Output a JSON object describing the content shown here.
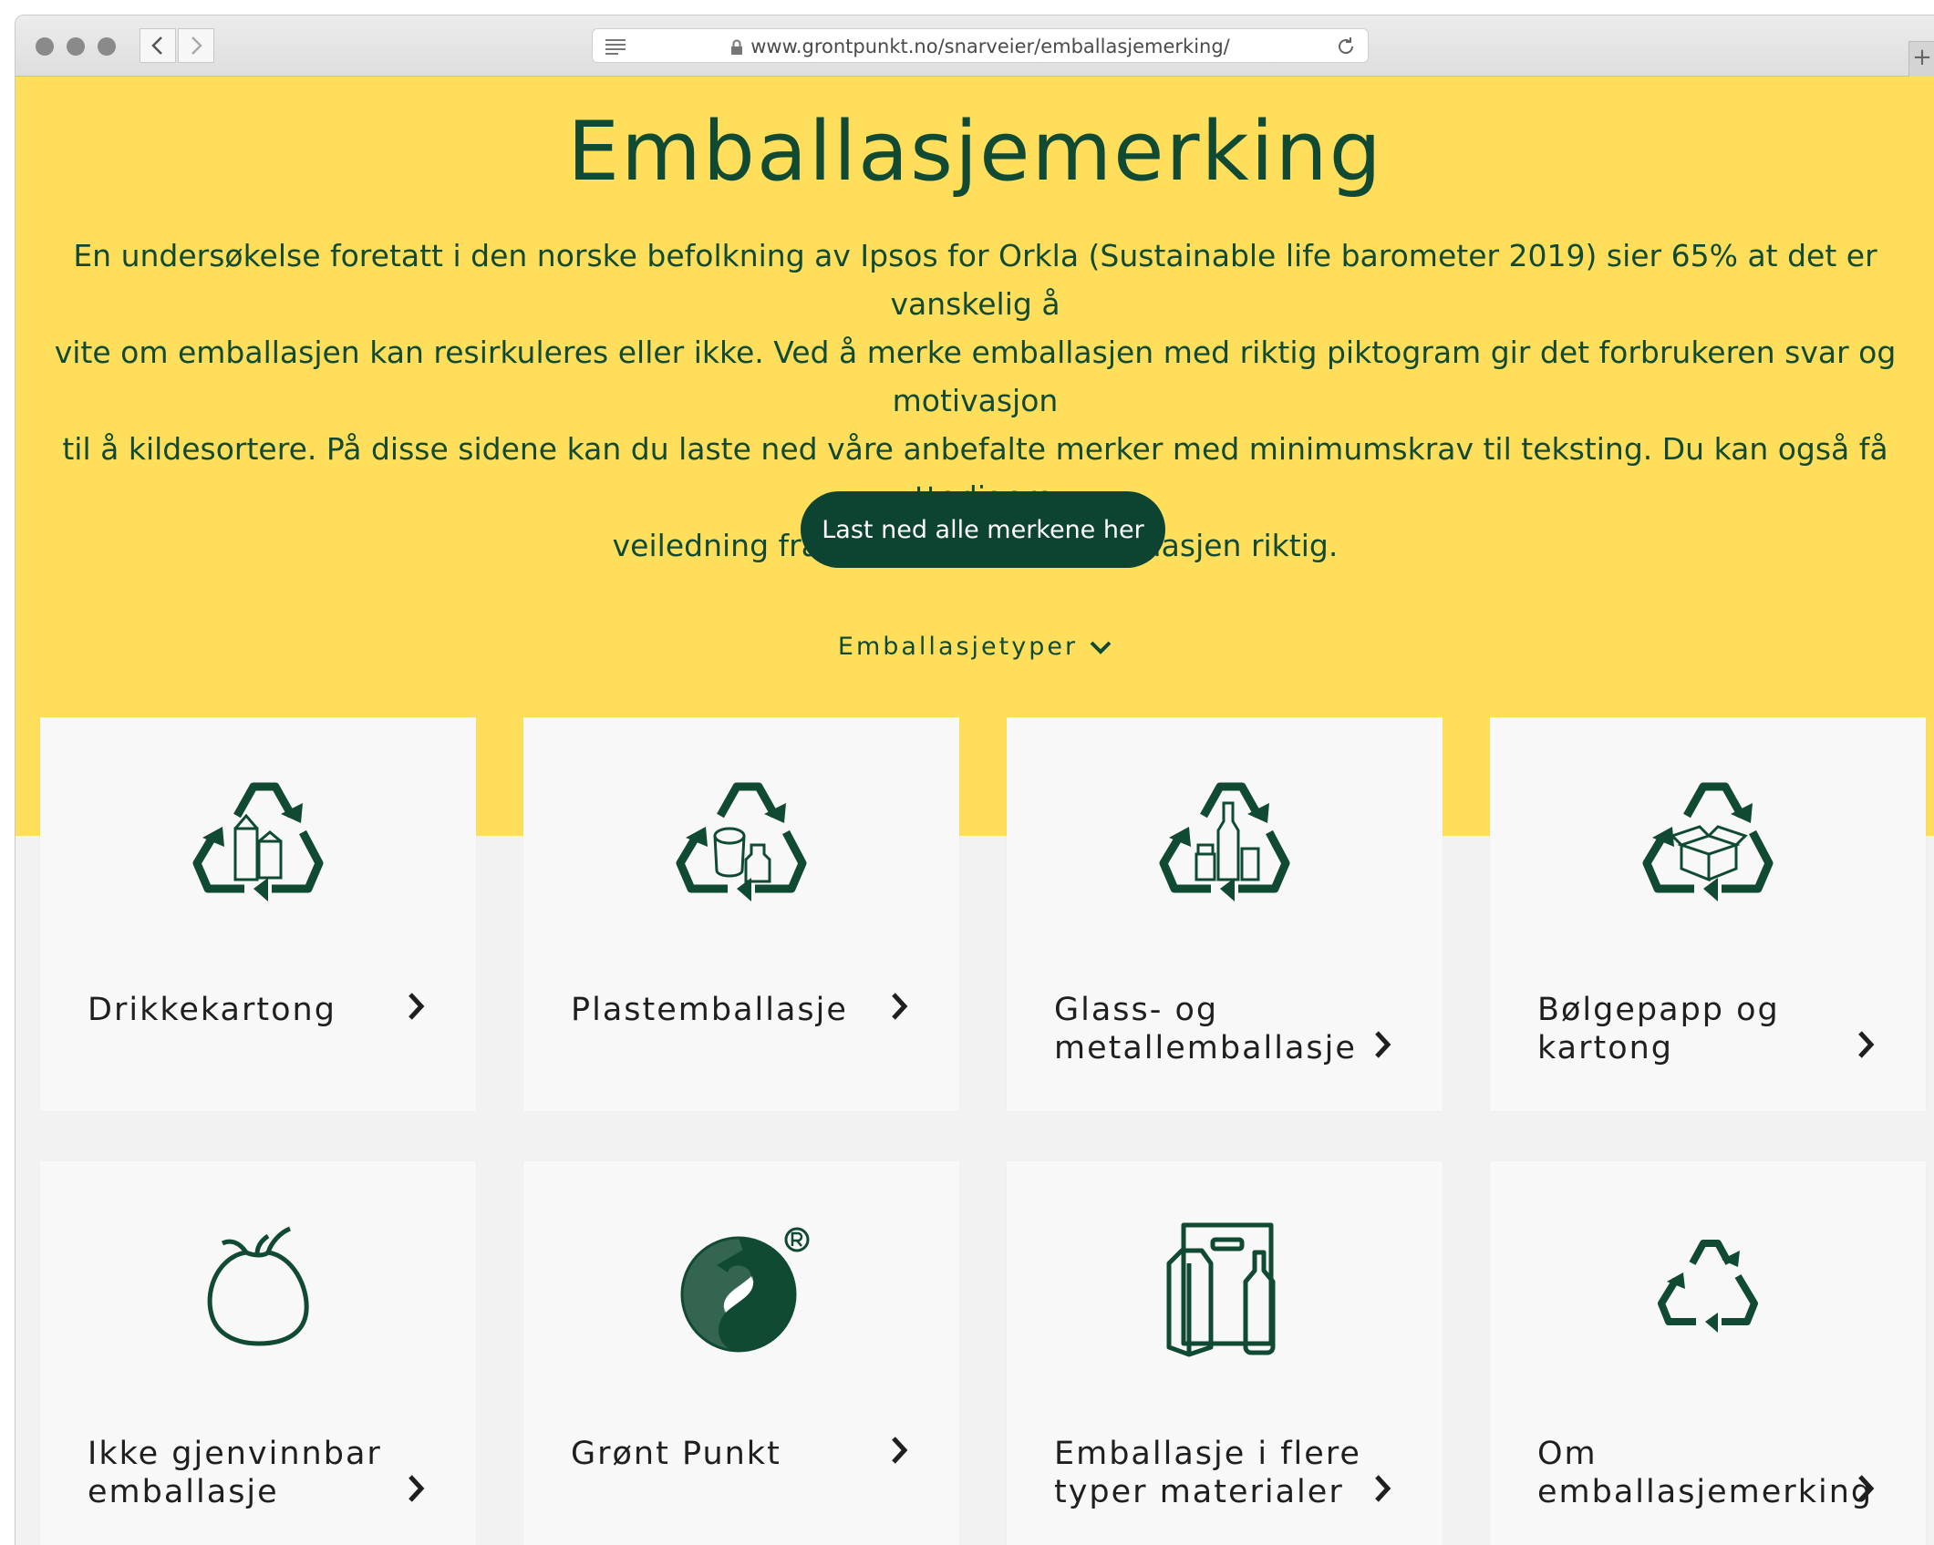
{
  "browser": {
    "url": "www.grontpunkt.no/snarveier/emballasjemerking/"
  },
  "page": {
    "title": "Emballasjemerking",
    "intro_lines": [
      "En undersøkelse foretatt i den norske befolkning av Ipsos for Orkla (Sustainable life barometer 2019) sier 65% at det er vanskelig å",
      "vite om emballasjen kan resirkuleres eller ikke. Ved å merke emballasjen med riktig piktogram gir det forbrukeren svar og motivasjon",
      "til å kildesortere. På disse sidene kan du laste ned våre anbefalte merker med minimumskrav til teksting. Du kan også få ytterligere",
      "veiledning fra oss til å merke emballasjen riktig."
    ],
    "download_button": "Last ned alle merkene her",
    "types_toggle": "Emballasjetyper"
  },
  "colors": {
    "hero_background": "#ffde5c",
    "brand_green": "#114a33",
    "button_green": "#0c4431"
  },
  "cards": [
    {
      "line1": "Drikkekartong",
      "line2": "",
      "icon": "recycle-carton-icon"
    },
    {
      "line1": "Plastemballasje",
      "line2": "",
      "icon": "recycle-plastic-icon"
    },
    {
      "line1": "Glass- og",
      "line2": "metallemballasje",
      "icon": "recycle-glass-metal-icon"
    },
    {
      "line1": "Bølgepapp og",
      "line2": "kartong",
      "icon": "recycle-cardboard-icon"
    },
    {
      "line1": "Ikke gjenvinnbar",
      "line2": "emballasje",
      "icon": "waste-bag-icon"
    },
    {
      "line1": "Grønt Punkt",
      "line2": "",
      "icon": "green-dot-icon"
    },
    {
      "line1": "Emballasje i flere",
      "line2": "typer materialer",
      "icon": "mixed-materials-icon"
    },
    {
      "line1": "Om",
      "line2": "emballasjemerking",
      "icon": "recycle-icon"
    }
  ]
}
